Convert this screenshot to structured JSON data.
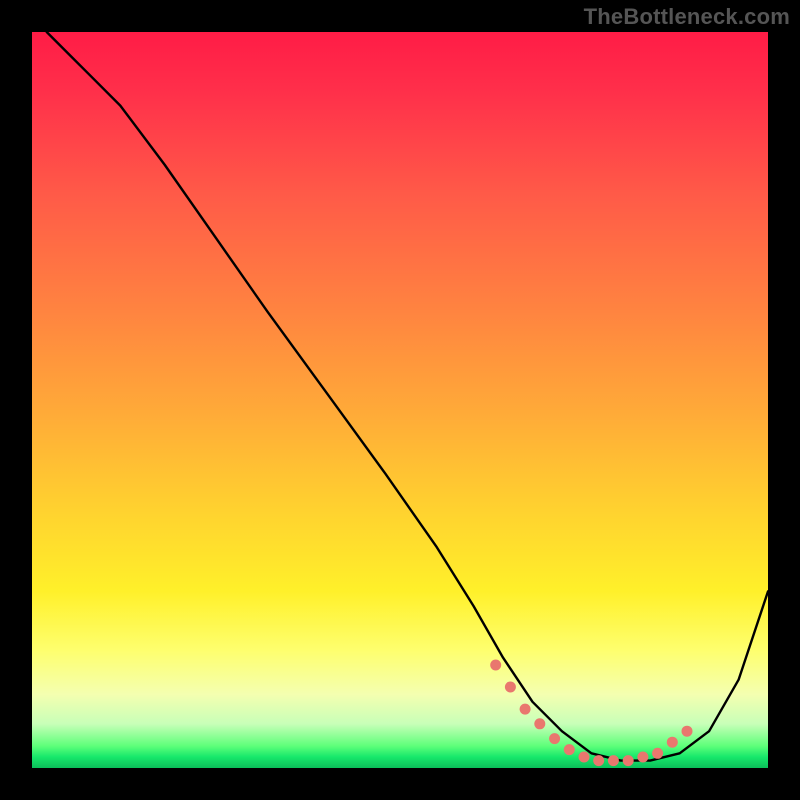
{
  "watermark": "TheBottleneck.com",
  "chart_data": {
    "type": "line",
    "title": "",
    "xlabel": "",
    "ylabel": "",
    "xlim": [
      0,
      100
    ],
    "ylim": [
      0,
      100
    ],
    "gradient_stops": [
      {
        "pct": 0,
        "color": "#ff1c46"
      },
      {
        "pct": 22,
        "color": "#ff5a48"
      },
      {
        "pct": 52,
        "color": "#ffab38"
      },
      {
        "pct": 76,
        "color": "#fff02a"
      },
      {
        "pct": 90,
        "color": "#f4ffb0"
      },
      {
        "pct": 97,
        "color": "#5eff7a"
      },
      {
        "pct": 100,
        "color": "#0bbf5a"
      }
    ],
    "series": [
      {
        "name": "bottleneck-curve",
        "x": [
          2,
          5,
          8,
          12,
          18,
          25,
          32,
          40,
          48,
          55,
          60,
          64,
          68,
          72,
          76,
          80,
          84,
          88,
          92,
          96,
          100
        ],
        "y": [
          100,
          97,
          94,
          90,
          82,
          72,
          62,
          51,
          40,
          30,
          22,
          15,
          9,
          5,
          2,
          1,
          1,
          2,
          5,
          12,
          24
        ]
      }
    ],
    "markers": {
      "name": "highlight-dots",
      "color": "#e9776e",
      "x": [
        63,
        65,
        67,
        69,
        71,
        73,
        75,
        77,
        79,
        81,
        83,
        85,
        87,
        89
      ],
      "y": [
        14,
        11,
        8,
        6,
        4,
        2.5,
        1.5,
        1,
        1,
        1,
        1.5,
        2,
        3.5,
        5
      ]
    }
  }
}
